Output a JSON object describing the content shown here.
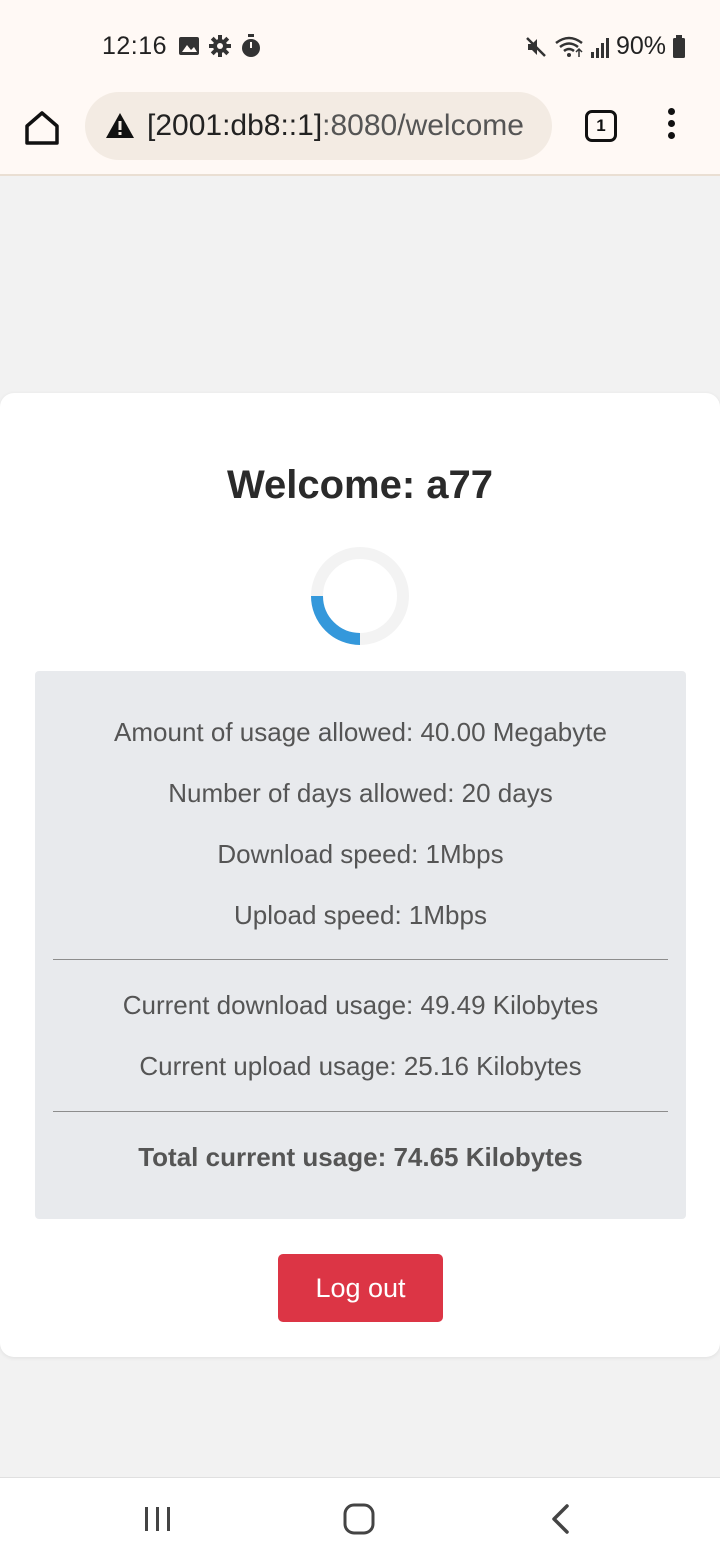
{
  "status_bar": {
    "time": "12:16",
    "battery": "90%",
    "left_icons": [
      "image-icon",
      "gear-icon",
      "timer-icon"
    ],
    "right_icons": [
      "mute-icon",
      "wifi-icon",
      "signal-icon",
      "battery-icon"
    ]
  },
  "browser": {
    "url_host": "[2001:db8::1]",
    "url_path": ":8080/welcome",
    "tab_count": "1",
    "security_icon": "warning-icon"
  },
  "page": {
    "title": "Welcome: a77",
    "limits": [
      "Amount of usage allowed: 40.00 Megabyte",
      "Number of days allowed: 20 days",
      "Download speed: 1Mbps",
      "Upload speed: 1Mbps"
    ],
    "usage": [
      "Current download usage: 49.49 Kilobytes",
      "Current upload usage: 25.16 Kilobytes"
    ],
    "total": "Total current usage: 74.65 Kilobytes",
    "logout_label": "Log out"
  },
  "colors": {
    "accent_red": "#dc3545",
    "spinner_blue": "#3498db",
    "spinner_track": "#f3f3f3",
    "info_bg": "#e8eaed"
  }
}
